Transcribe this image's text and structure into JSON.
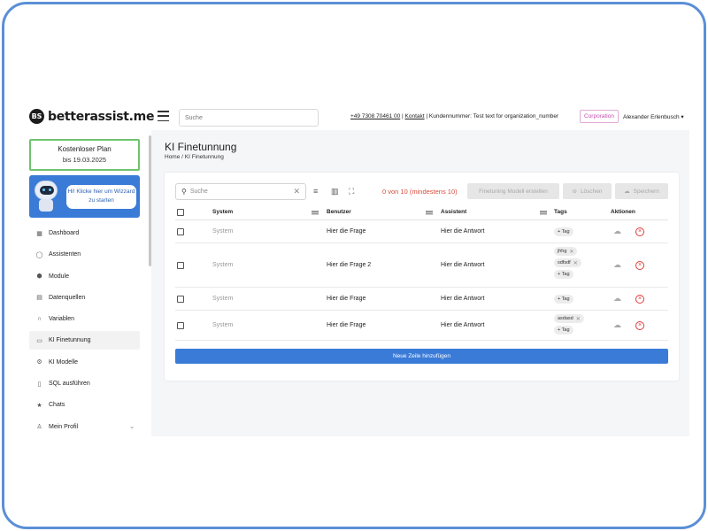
{
  "brand": {
    "logo_mark": "BS",
    "name": "betterassist.me"
  },
  "topbar": {
    "search_placeholder": "Suche",
    "phone": "+49 7308 70461 00",
    "separator": "|",
    "contact": "Kontakt",
    "customer": "Kundennummer: Test text for organization_number",
    "badge": "Corporation",
    "user": "Alexander Erlenbusch ▾"
  },
  "sidebar": {
    "plan_title": "Kostenloser Plan",
    "plan_date": "bis 19.03.2025",
    "wizard_text": "Hi! Klicke hier um Wizzard zu starten",
    "items": [
      {
        "label": "Dashboard",
        "icon": "dashboard-icon",
        "glyph": "▦"
      },
      {
        "label": "Assistenten",
        "icon": "chat-bubble-icon",
        "glyph": "◯"
      },
      {
        "label": "Module",
        "icon": "cube-icon",
        "glyph": "⬢"
      },
      {
        "label": "Datenquellen",
        "icon": "database-icon",
        "glyph": "▤"
      },
      {
        "label": "Variablen",
        "icon": "headset-icon",
        "glyph": "∩"
      },
      {
        "label": "KI Finetunnung",
        "icon": "briefcase-icon",
        "glyph": "▭"
      },
      {
        "label": "KI Modelle",
        "icon": "robot-icon",
        "glyph": "⚙"
      },
      {
        "label": "SQL ausführen",
        "icon": "document-icon",
        "glyph": "▯"
      },
      {
        "label": "Chats",
        "icon": "star-icon",
        "glyph": "★"
      },
      {
        "label": "Mein Profil",
        "icon": "person-icon",
        "glyph": "♙",
        "chevron": "⌄"
      }
    ]
  },
  "main": {
    "title": "KI Finetunnung",
    "breadcrumb_home": "Home",
    "breadcrumb_sep": "/",
    "breadcrumb_current": "KI Finetunnung",
    "search_placeholder": "Suche",
    "count_text": "0 von 10 (mindestens 10)",
    "btn_create": "Finetuning Modell erstellen",
    "btn_delete": "Löschen",
    "btn_save": "Speichern",
    "columns": {
      "system": "System",
      "user": "Benutzer",
      "assistant": "Assistent",
      "tags": "Tags",
      "actions": "Aktionen"
    },
    "rows": [
      {
        "system": "System",
        "user": "Hier die Frage",
        "assistant": "Hier die Antwort",
        "tags": []
      },
      {
        "system": "System",
        "user": "Hier die Frage 2",
        "assistant": "Hier die Antwort",
        "tags": [
          "jhhg",
          "sdfsdf"
        ]
      },
      {
        "system": "System",
        "user": "Hier die Frage",
        "assistant": "Hier die Antwort",
        "tags": []
      },
      {
        "system": "System",
        "user": "Hier die Frage",
        "assistant": "Hier die Antwort",
        "tags": [
          "asdasd"
        ]
      }
    ],
    "add_tag_label": "+ Tag",
    "add_row": "Neue Zeile hinzufügen"
  },
  "colors": {
    "accent": "#3a7bd8",
    "frame": "#5b8fd6",
    "danger": "#e03b3b",
    "plan_border": "#6fc36f"
  }
}
